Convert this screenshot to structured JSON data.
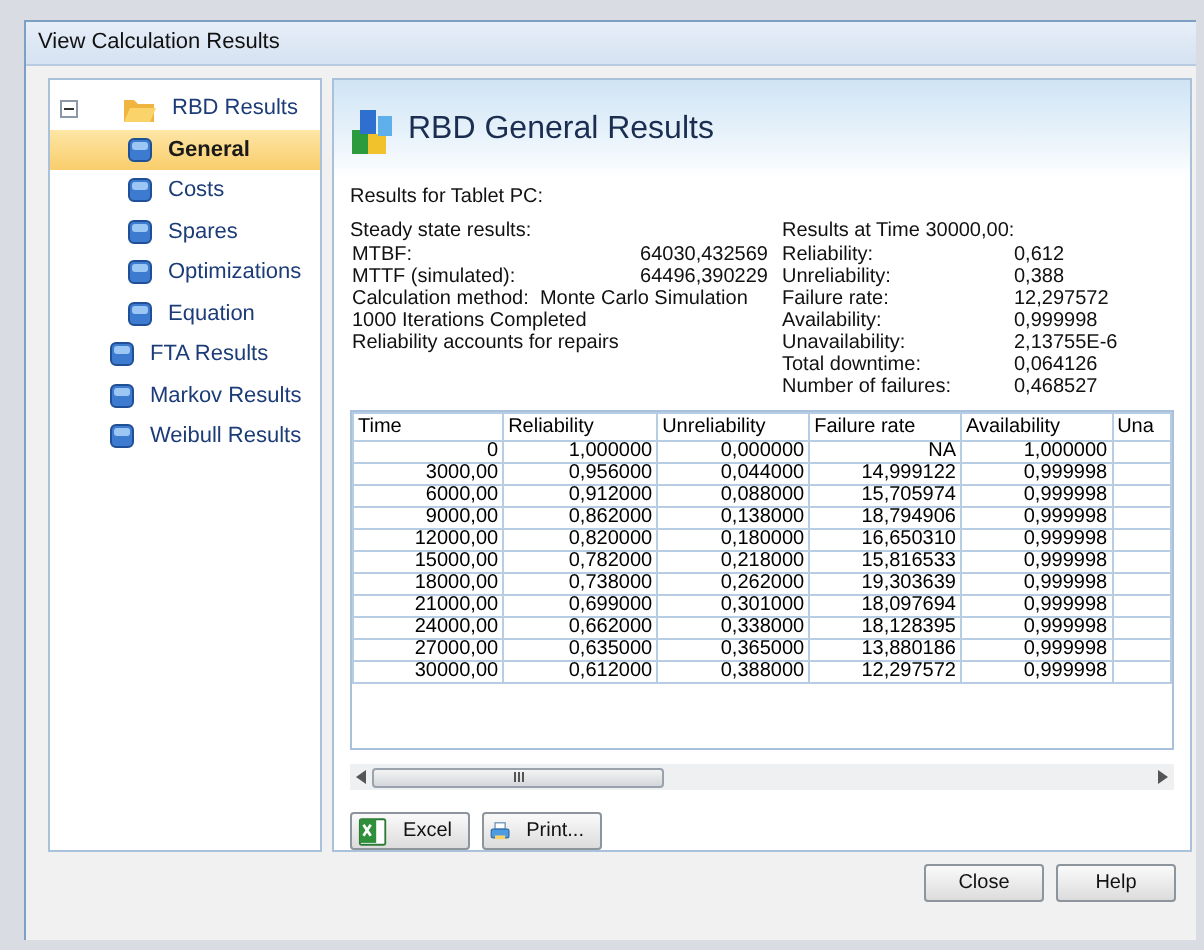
{
  "window": {
    "title": "View Calculation Results"
  },
  "tree": [
    {
      "label": "RBD Results",
      "expanded": true,
      "selected": false,
      "children": [
        {
          "label": "General",
          "selected": true
        },
        {
          "label": "Costs",
          "selected": false
        },
        {
          "label": "Spares",
          "selected": false
        },
        {
          "label": "Optimizations",
          "selected": false
        },
        {
          "label": "Equation",
          "selected": false
        }
      ]
    },
    {
      "label": "FTA Results",
      "selected": false
    },
    {
      "label": "Markov Results",
      "selected": false
    },
    {
      "label": "Weibull Results",
      "selected": false
    }
  ],
  "header": {
    "title": "RBD General Results"
  },
  "summary": {
    "subject": "Results for Tablet PC:",
    "steady": {
      "heading": "Steady state results:",
      "metrics": [
        {
          "label": "MTBF:",
          "value": "64030,432569"
        },
        {
          "label": "MTTF (simulated):",
          "value": "64496,390229"
        }
      ],
      "notes": [
        "Calculation method:  Monte Carlo Simulation",
        "1000 Iterations Completed",
        "Reliability accounts for repairs"
      ]
    },
    "at_time": {
      "heading": "Results at Time 30000,00:",
      "metrics": [
        {
          "label": "Reliability:",
          "value": "0,612"
        },
        {
          "label": "Unreliability:",
          "value": "0,388"
        },
        {
          "label": "Failure rate:",
          "value": "12,297572"
        },
        {
          "label": "Availability:",
          "value": "0,999998"
        },
        {
          "label": "Unavailability:",
          "value": "2,13755E-6"
        },
        {
          "label": "Total downtime:",
          "value": "0,064126"
        },
        {
          "label": "Number of failures:",
          "value": "0,468527"
        }
      ]
    }
  },
  "table": {
    "columns": [
      "Time",
      "Reliability",
      "Unreliability",
      "Failure rate",
      "Availability",
      "Una"
    ],
    "rows": [
      [
        "0",
        "1,000000",
        "0,000000",
        "NA",
        "1,000000"
      ],
      [
        "3000,00",
        "0,956000",
        "0,044000",
        "14,999122",
        "0,999998"
      ],
      [
        "6000,00",
        "0,912000",
        "0,088000",
        "15,705974",
        "0,999998"
      ],
      [
        "9000,00",
        "0,862000",
        "0,138000",
        "18,794906",
        "0,999998"
      ],
      [
        "12000,00",
        "0,820000",
        "0,180000",
        "16,650310",
        "0,999998"
      ],
      [
        "15000,00",
        "0,782000",
        "0,218000",
        "15,816533",
        "0,999998"
      ],
      [
        "18000,00",
        "0,738000",
        "0,262000",
        "19,303639",
        "0,999998"
      ],
      [
        "21000,00",
        "0,699000",
        "0,301000",
        "18,097694",
        "0,999998"
      ],
      [
        "24000,00",
        "0,662000",
        "0,338000",
        "18,128395",
        "0,999998"
      ],
      [
        "27000,00",
        "0,635000",
        "0,365000",
        "13,880186",
        "0,999998"
      ],
      [
        "30000,00",
        "0,612000",
        "0,388000",
        "12,297572",
        "0,999998"
      ]
    ]
  },
  "export_buttons": [
    {
      "kind": "excel",
      "label": "Excel"
    },
    {
      "kind": "print",
      "label": "Print..."
    }
  ],
  "buttons": [
    "Close",
    "Help"
  ]
}
